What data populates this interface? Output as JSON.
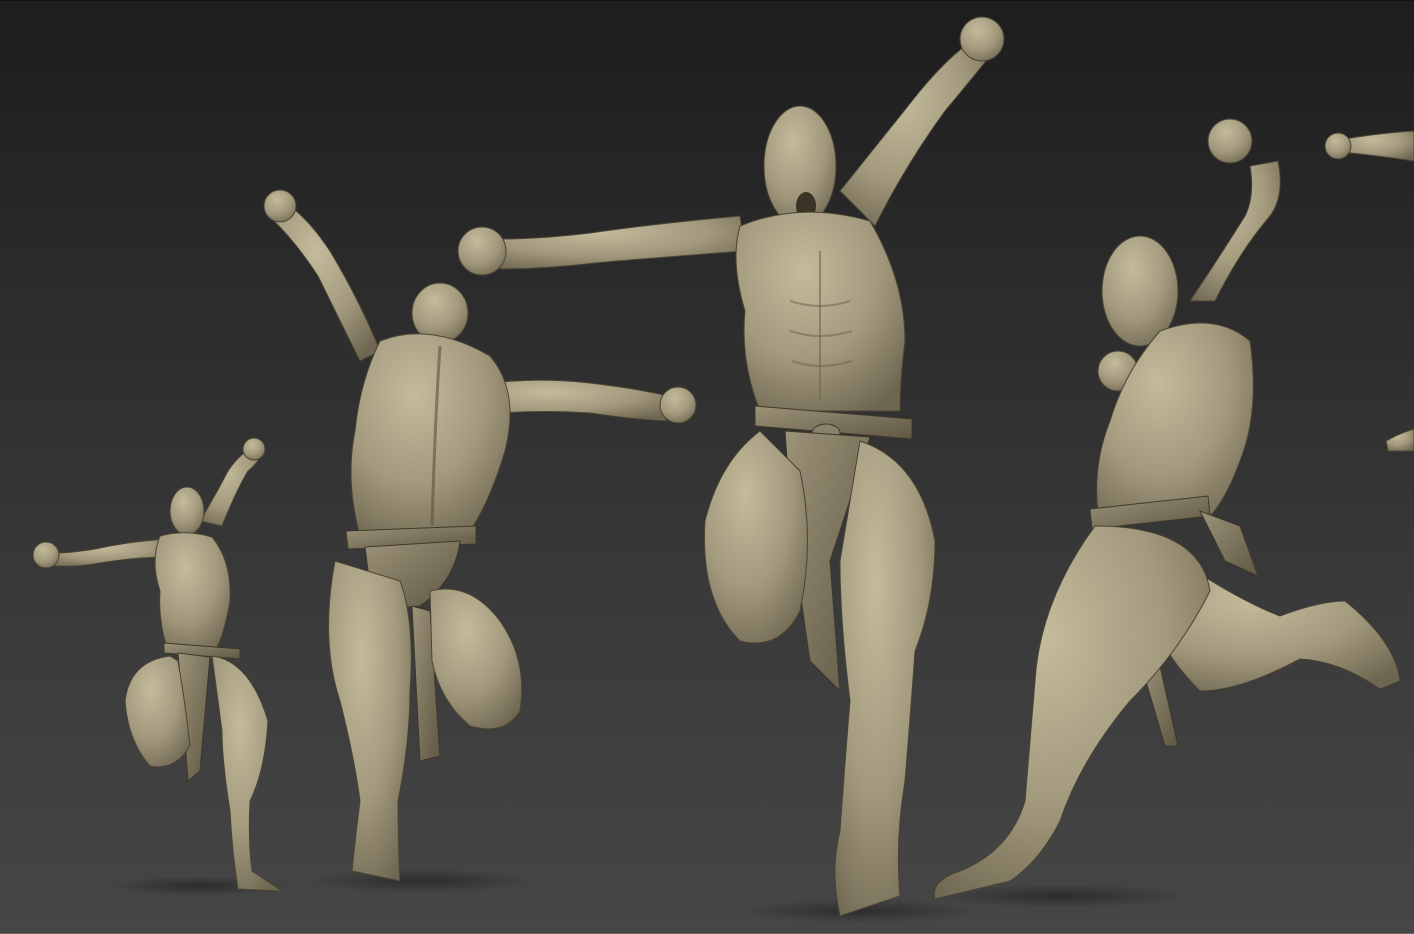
{
  "scene": {
    "kind": "3d-sculpt-viewport",
    "background_top": "#1d1d1d",
    "background_bottom": "#464646",
    "material_color": "#a39a7e",
    "material_shadow": "#5f5744",
    "figures": [
      {
        "id": "figure-small-left",
        "view": "front-three-quarter"
      },
      {
        "id": "figure-back",
        "view": "back"
      },
      {
        "id": "figure-front-center",
        "view": "front"
      },
      {
        "id": "figure-side-right",
        "view": "side"
      },
      {
        "id": "figure-partial-edge",
        "view": "cropped"
      }
    ]
  }
}
